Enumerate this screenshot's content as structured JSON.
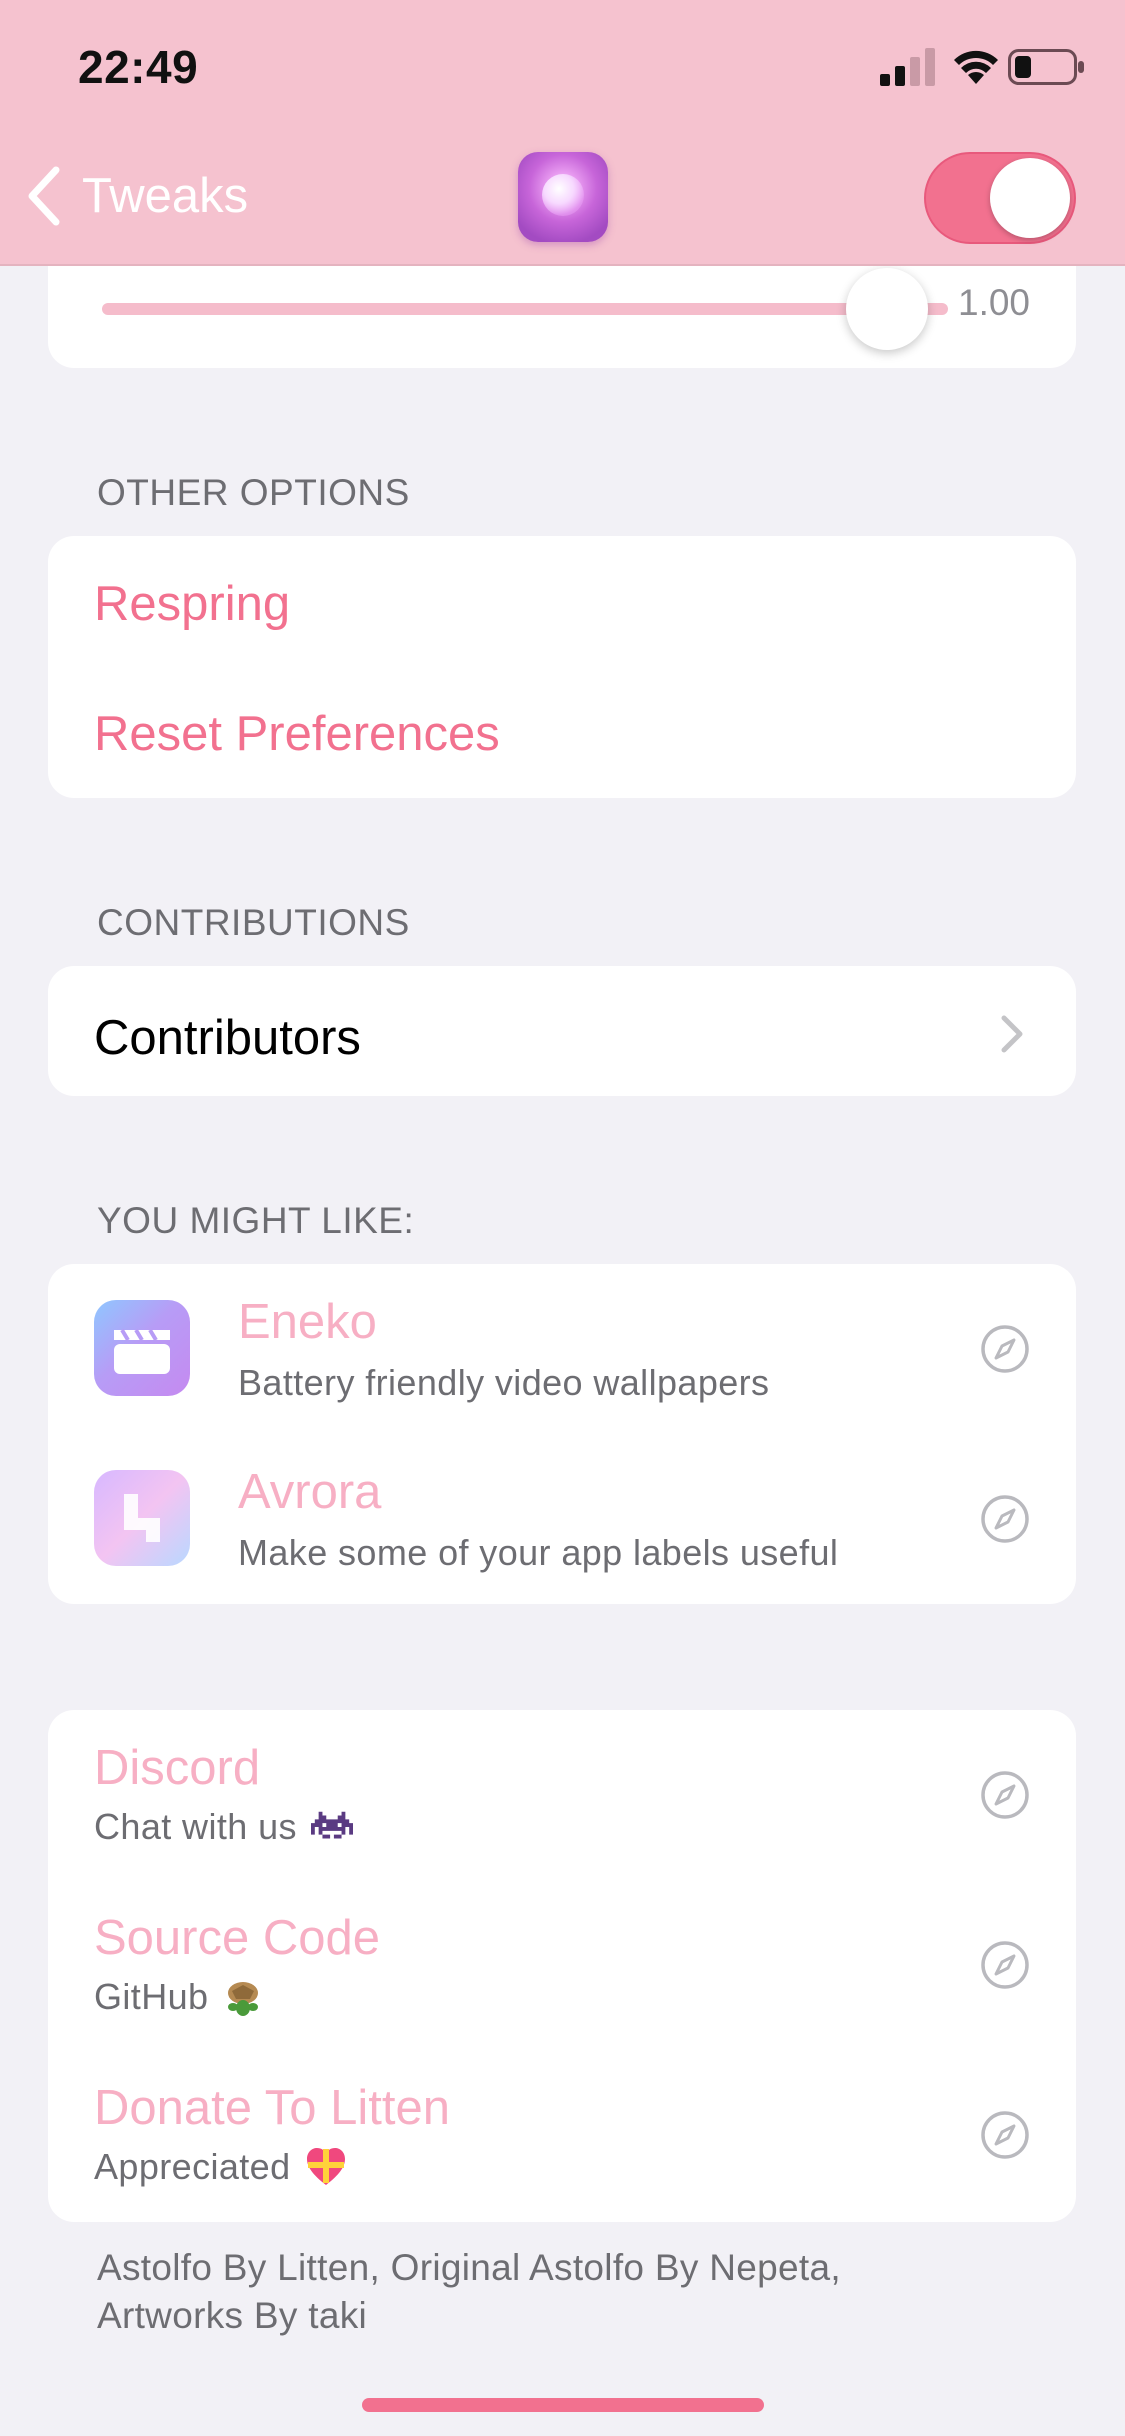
{
  "status_bar": {
    "time": "22:49"
  },
  "nav": {
    "back_label": "Tweaks",
    "enabled": true,
    "accent": "#f2718f",
    "bar_color": "#f5c2cf"
  },
  "slider": {
    "value": 1.0,
    "value_label": "1.00"
  },
  "other_options": {
    "header": "OTHER OPTIONS",
    "respring": "Respring",
    "reset": "Reset Preferences"
  },
  "contributions": {
    "header": "CONTRIBUTIONS",
    "contributors": "Contributors"
  },
  "you_might_like": {
    "header": "YOU MIGHT LIKE:",
    "items": [
      {
        "title": "Eneko",
        "subtitle": "Battery friendly video wallpapers",
        "icon": "clapperboard-icon"
      },
      {
        "title": "Avrora",
        "subtitle": "Make some of your app labels useful",
        "icon": "avrora-icon"
      }
    ]
  },
  "links": {
    "items": [
      {
        "title": "Discord",
        "subtitle": "Chat with us",
        "emoji": "space-invader-emoji"
      },
      {
        "title": "Source Code",
        "subtitle": "GitHub",
        "emoji": "turtle-emoji"
      },
      {
        "title": "Donate To Litten",
        "subtitle": "Appreciated",
        "emoji": "gift-heart-emoji"
      }
    ]
  },
  "footer": {
    "line1": "Astolfo By Litten, Original Astolfo By Nepeta,",
    "line2": "Artworks By taki"
  }
}
